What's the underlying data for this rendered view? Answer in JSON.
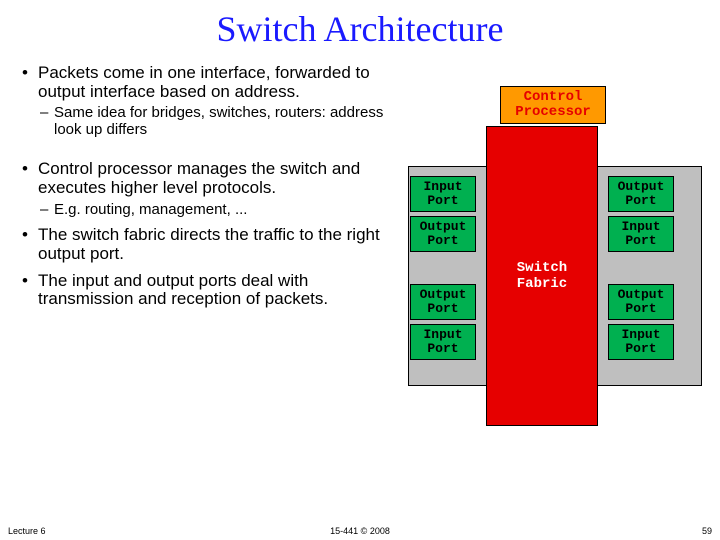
{
  "title": "Switch Architecture",
  "bullets": {
    "b1": "Packets come in one interface, forwarded to output interface based on address.",
    "b1s": "Same idea for bridges, switches, routers: address look up differs",
    "b2": "Control processor manages the switch and executes higher level protocols.",
    "b2s": "E.g. routing, management, ...",
    "b3": "The switch fabric directs the traffic to the right output port.",
    "b4": "The input and output ports deal with transmission and reception of packets."
  },
  "diagram": {
    "control": "Control\nProcessor",
    "fabric": "Switch\nFabric",
    "ports": {
      "l1": "Input\nPort",
      "l2": "Output\nPort",
      "l3": "Output\nPort",
      "l4": "Input\nPort",
      "r1": "Output\nPort",
      "r2": "Input\nPort",
      "r3": "Output\nPort",
      "r4": "Input\nPort"
    }
  },
  "footer": {
    "left": "Lecture 6",
    "center": "15-441  © 2008",
    "right": "59"
  }
}
